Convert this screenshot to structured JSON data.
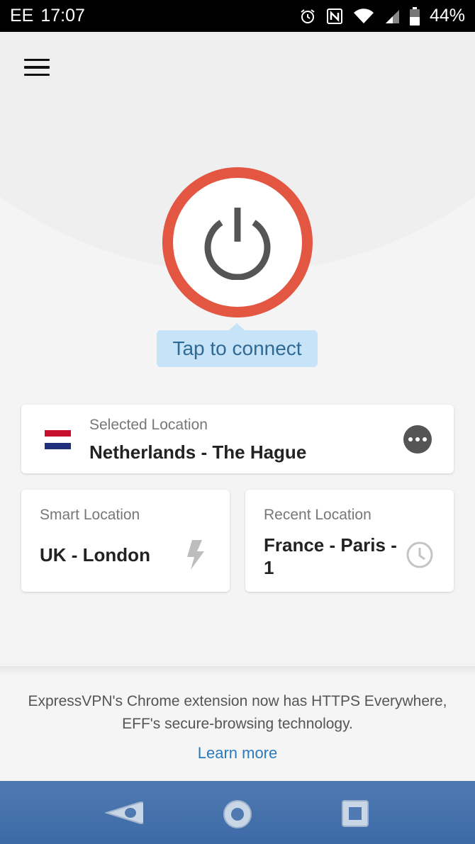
{
  "status_bar": {
    "carrier": "EE",
    "time": "17:07",
    "battery": "44%",
    "icons": [
      "alarm-icon",
      "nfc-icon",
      "wifi-icon",
      "signal-icon",
      "battery-icon"
    ]
  },
  "app": {
    "menu_icon": "hamburger-menu-icon",
    "power_icon": "power-icon",
    "tooltip": "Tap to connect",
    "selected_location": {
      "label": "Selected Location",
      "value": "Netherlands - The Hague",
      "flag_colors": [
        "#c8102e",
        "#ffffff",
        "#21307a"
      ]
    },
    "smart_location": {
      "label": "Smart Location",
      "value": "UK - London",
      "icon": "lightning-bolt-icon"
    },
    "recent_location": {
      "label": "Recent Location",
      "value": "France - Paris - 1",
      "icon": "clock-icon"
    },
    "banner": {
      "text": "ExpressVPN's Chrome extension now has HTTPS Everywhere, EFF's secure-browsing technology.",
      "link": "Learn more"
    }
  },
  "colors": {
    "accent": "#e35641",
    "tooltip_bg": "#c7e3f7",
    "tooltip_text": "#2f6a95",
    "link": "#2a7abf",
    "nav_bar": "#4572ab"
  },
  "nav_bar": {
    "buttons": [
      "back-icon",
      "home-icon",
      "recents-icon"
    ]
  }
}
